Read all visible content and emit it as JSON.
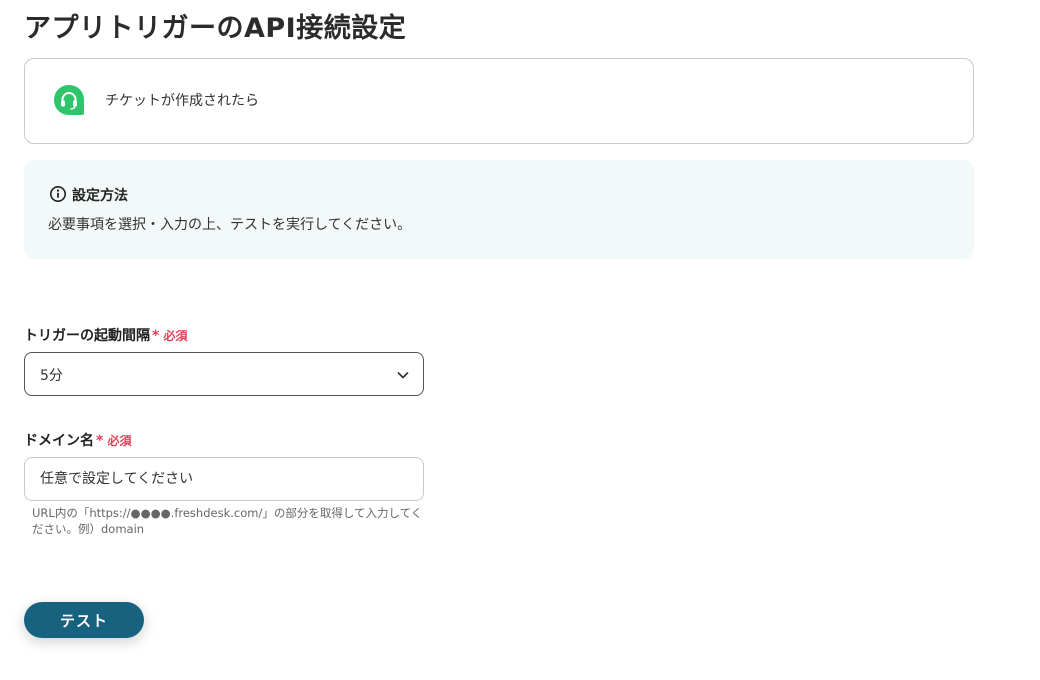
{
  "page": {
    "title": "アプリトリガーのAPI接続設定"
  },
  "trigger": {
    "label": "チケットが作成されたら",
    "icon": "headset-icon",
    "icon_color": "#2ec56b"
  },
  "info": {
    "icon": "info-icon",
    "title": "設定方法",
    "text": "必要事項を選択・入力の上、テストを実行してください。",
    "background": "#f2f9f8"
  },
  "fields": {
    "interval": {
      "label": "トリガーの起動間隔",
      "required_mark": "*",
      "required_text": "必須",
      "value": "5分"
    },
    "domain": {
      "label": "ドメイン名",
      "required_mark": "*",
      "required_text": "必須",
      "placeholder": "任意で設定してください",
      "value": "",
      "help": "URL内の「https://●●●●.freshdesk.com/」の部分を取得して入力してください。例）domain"
    }
  },
  "actions": {
    "test_label": "テスト",
    "button_color": "#17627f"
  },
  "colors": {
    "required": "#e0435b"
  }
}
